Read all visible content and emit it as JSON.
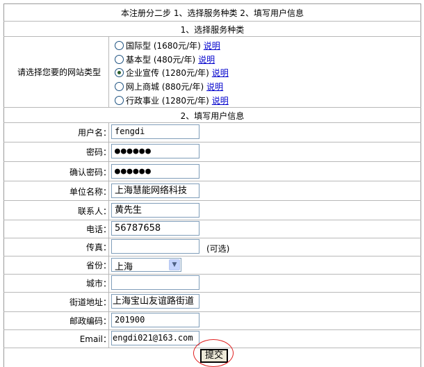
{
  "header": {
    "title": "本注册分二步 1、选择服务种类 2、填写用户信息"
  },
  "section1": {
    "title": "1、选择服务种类",
    "prompt": "请选择您要的网站类型",
    "options": [
      {
        "label": "国际型",
        "price": "(1680元/年)",
        "link": "说明",
        "selected": false
      },
      {
        "label": "基本型",
        "price": "(480元/年)",
        "link": "说明",
        "selected": false
      },
      {
        "label": "企业宣传",
        "price": "(1280元/年)",
        "link": "说明",
        "selected": true
      },
      {
        "label": "网上商城",
        "price": "(880元/年)",
        "link": "说明",
        "selected": false
      },
      {
        "label": "行政事业",
        "price": "(1280元/年)",
        "link": "说明",
        "selected": false
      }
    ]
  },
  "section2": {
    "title": "2、填写用户信息",
    "fields": {
      "username": {
        "label": "用户名：",
        "value": "fengdi"
      },
      "password": {
        "label": "密码：",
        "value": "●●●●●●"
      },
      "confirm": {
        "label": "确认密码：",
        "value": "●●●●●●"
      },
      "company": {
        "label": "单位名称：",
        "value": "上海慧能网络科技"
      },
      "contact": {
        "label": "联系人：",
        "value": "黄先生"
      },
      "phone": {
        "label": "电话：",
        "value": "56787658"
      },
      "fax": {
        "label": "传真：",
        "value": "",
        "note": "(可选)"
      },
      "province": {
        "label": "省份：",
        "value": "上海"
      },
      "city": {
        "label": "城市：",
        "value": ""
      },
      "street": {
        "label": "街道地址：",
        "value": "上海宝山友谊路街道"
      },
      "zipcode": {
        "label": "邮政编码：",
        "value": "201900"
      },
      "email": {
        "label": "Email：",
        "value": "engdi021@163.com"
      }
    },
    "submit_label": "提交"
  },
  "colors": {
    "border": "#b8b8b8",
    "link": "#0000cc",
    "annotation_circle": "#e02020",
    "input_border": "#7f9db9"
  }
}
